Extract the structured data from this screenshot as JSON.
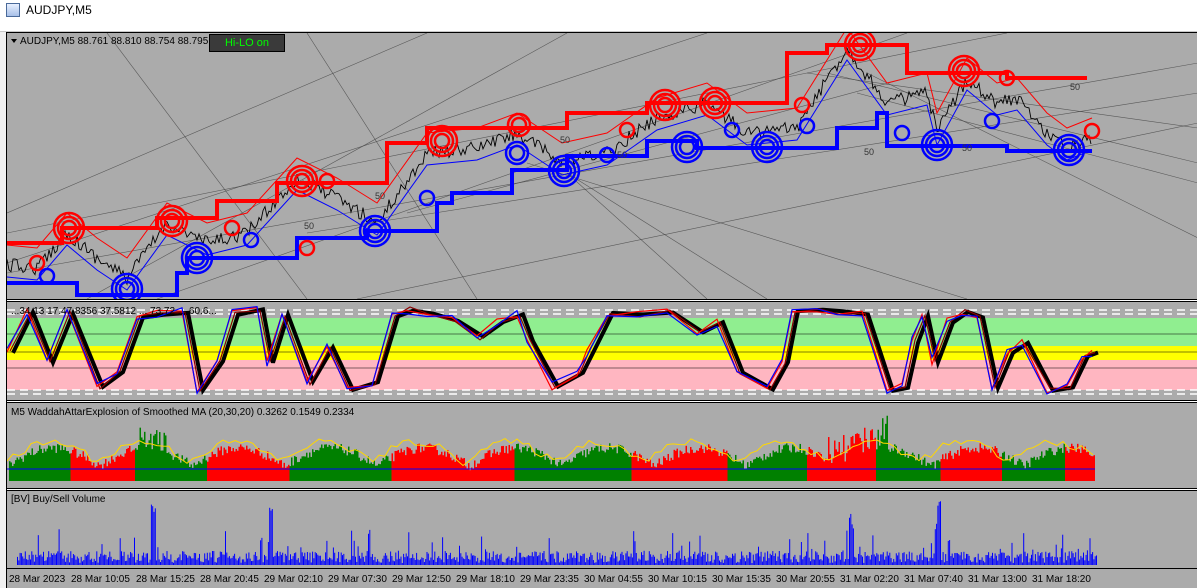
{
  "window": {
    "title": "AUDJPY,M5"
  },
  "main_chart": {
    "label": "AUDJPY,M5  88.761 88.810 88.754 88.795",
    "hilo_button": "Hi-LO on",
    "level_labels": [
      "50",
      "50",
      "50",
      "50",
      "50",
      "50",
      "50"
    ]
  },
  "stoch_pane": {
    "label": "...34.13 17.47 8356 37.5812 ... 73.72 ... 60.6..."
  },
  "waddah_pane": {
    "label": "M5  WaddahAttarExplosion of Smoothed MA (20,30,20) 0.3262 0.1549 0.2334"
  },
  "volume_pane": {
    "label": "[BV] Buy/Sell Volume"
  },
  "time_axis": {
    "labels": [
      "28 Mar 2023",
      "28 Mar 10:05",
      "28 Mar 15:25",
      "28 Mar 20:45",
      "29 Mar 02:10",
      "29 Mar 07:30",
      "29 Mar 12:50",
      "29 Mar 18:10",
      "29 Mar 23:35",
      "30 Mar 04:55",
      "30 Mar 10:15",
      "30 Mar 15:35",
      "30 Mar 20:55",
      "31 Mar 02:20",
      "31 Mar 07:40",
      "31 Mar 13:00",
      "31 Mar 18:20"
    ]
  },
  "colors": {
    "background": "#ababab",
    "resistance": "#ff0000",
    "support": "#0000ff",
    "bullish": "#008000",
    "bearish": "#ff0000",
    "stoch_overbought": "#90ee90",
    "stoch_mid": "#ffff00",
    "stoch_oversold": "#ffb6c1"
  }
}
